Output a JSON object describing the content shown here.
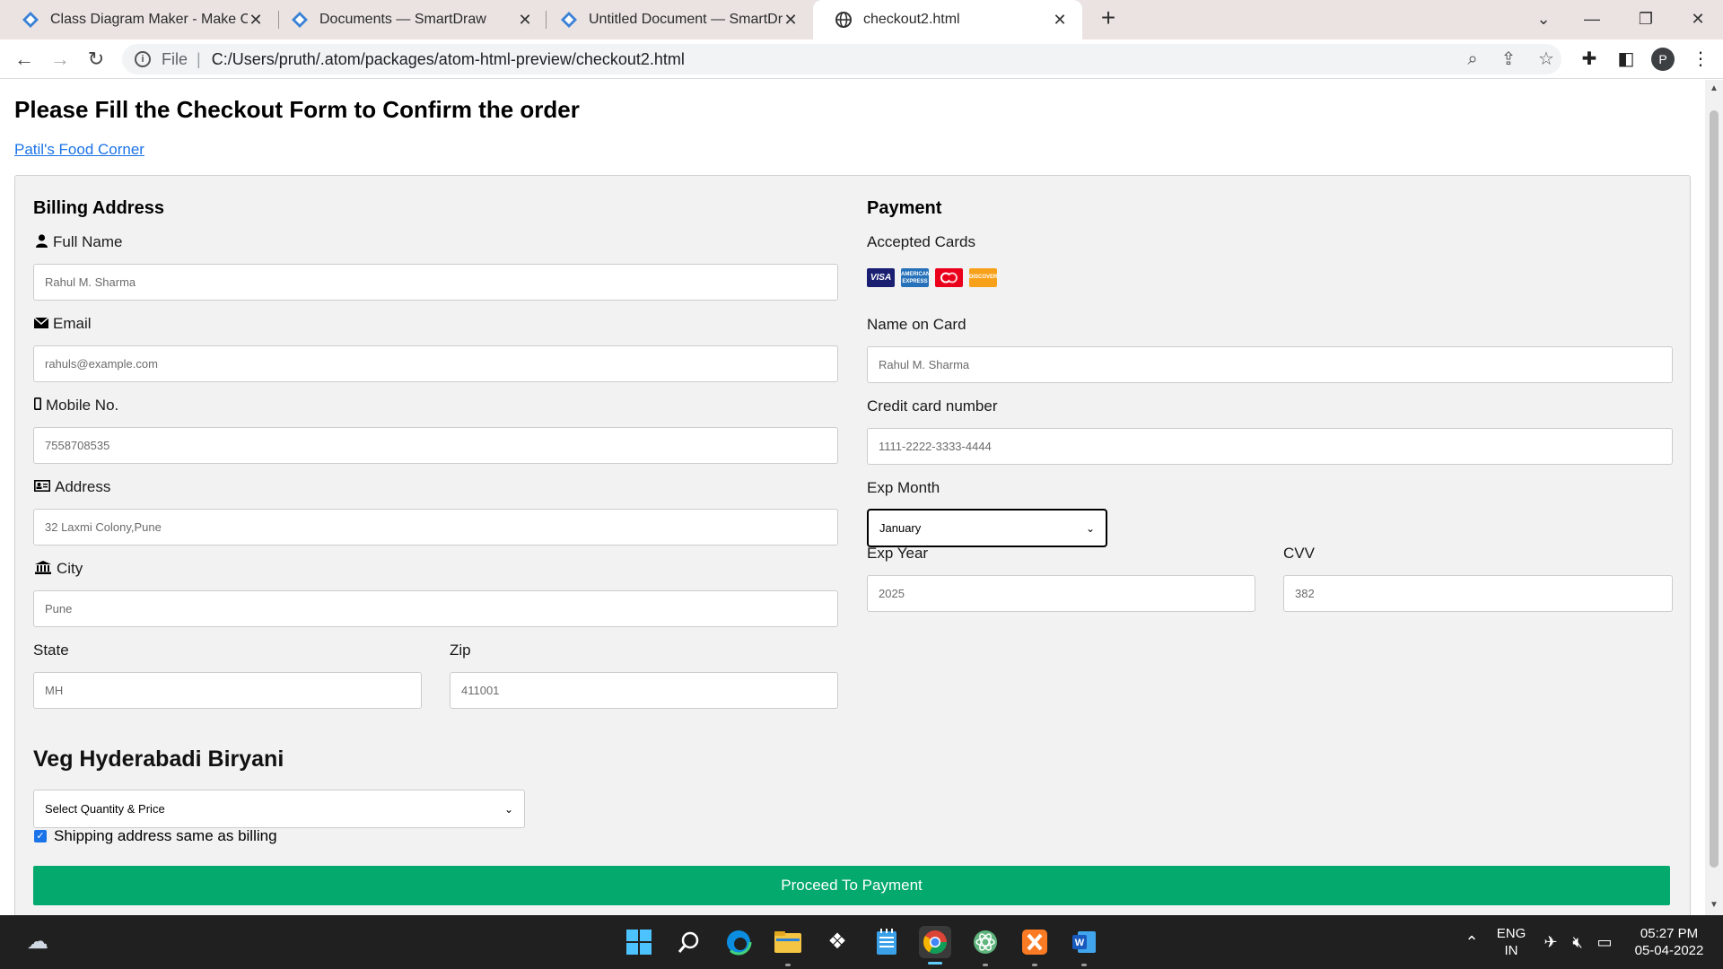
{
  "browser": {
    "tabs": [
      {
        "title": "Class Diagram Maker - Make Class Diagrams Online",
        "active": false
      },
      {
        "title": "Documents — SmartDraw",
        "active": false
      },
      {
        "title": "Untitled Document — SmartDraw",
        "active": false
      },
      {
        "title": "checkout2.html",
        "active": true
      }
    ],
    "scheme": "File",
    "url": "C:/Users/pruth/.atom/packages/atom-html-preview/checkout2.html",
    "profile_initial": "P"
  },
  "page": {
    "title": "Please Fill the Checkout Form to Confirm the order",
    "brand_link": "Patil's Food Corner"
  },
  "billing": {
    "heading": "Billing Address",
    "full_name": {
      "label": "Full Name",
      "placeholder": "Rahul M. Sharma",
      "icon": "user-icon"
    },
    "email": {
      "label": "Email",
      "placeholder": "rahuls@example.com",
      "icon": "envelope-icon"
    },
    "mobile": {
      "label": "Mobile No.",
      "placeholder": "7558708535",
      "icon": "mobile-icon"
    },
    "address": {
      "label": "Address",
      "placeholder": "32 Laxmi Colony,Pune",
      "icon": "address-card-icon"
    },
    "city": {
      "label": "City",
      "placeholder": "Pune",
      "icon": "institution-icon"
    },
    "state": {
      "label": "State",
      "placeholder": "MH"
    },
    "zip": {
      "label": "Zip",
      "placeholder": "411001"
    }
  },
  "payment": {
    "heading": "Payment",
    "accepted_cards_label": "Accepted Cards",
    "cards": [
      "VISA",
      "AMEX",
      "MC",
      "DISCOVER"
    ],
    "name_on_card": {
      "label": "Name on Card",
      "placeholder": "Rahul M. Sharma"
    },
    "card_number": {
      "label": "Credit card number",
      "placeholder": "1111-2222-3333-4444"
    },
    "exp_month": {
      "label": "Exp Month",
      "selected": "January"
    },
    "exp_year": {
      "label": "Exp Year",
      "placeholder": "2025"
    },
    "cvv": {
      "label": "CVV",
      "placeholder": "382"
    }
  },
  "order": {
    "product_title": "Veg Hyderabadi Biryani",
    "quantity_select": "Select Quantity & Price",
    "shipping_same_label": "Shipping address same as billing",
    "shipping_same_checked": true,
    "submit_label": "Proceed To Payment"
  },
  "taskbar": {
    "lang_top": "ENG",
    "lang_bottom": "IN",
    "time": "05:27 PM",
    "date": "05-04-2022"
  },
  "colors": {
    "submit": "#04aa6d",
    "link": "#1a73e8",
    "form_bg": "#f2f2f2"
  }
}
